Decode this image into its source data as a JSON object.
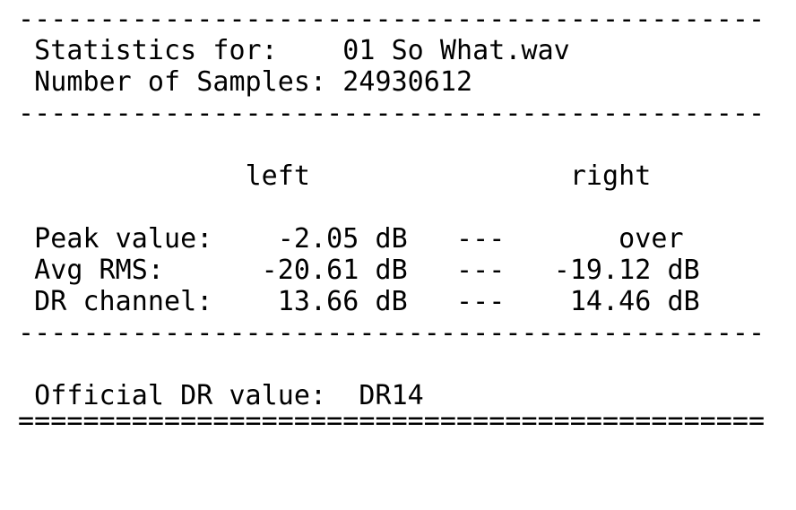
{
  "report": {
    "separator_dash": "----------------------------------------------",
    "separator_equals": "==============================================",
    "header": {
      "statistics_label": " Statistics for:    ",
      "statistics_value": "01 So What.wav",
      "samples_label": " Number of Samples: ",
      "samples_value": "24930612"
    },
    "columns": {
      "spacer": "              ",
      "left_label": "left",
      "gap": "                ",
      "right_label": "right"
    },
    "rows": [
      {
        "label": " Peak value:  ",
        "left": "  -2.05 dB",
        "sep": "   ---   ",
        "right": "    over"
      },
      {
        "label": " Avg RMS:     ",
        "left": " -20.61 dB",
        "sep": "   ---   ",
        "right": "-19.12 dB"
      },
      {
        "label": " DR channel:  ",
        "left": "  13.66 dB",
        "sep": "   ---   ",
        "right": " 14.46 dB"
      }
    ],
    "official": {
      "label": " Official DR value:  ",
      "value": "DR14"
    }
  },
  "chart_data": {
    "type": "table",
    "title": "Statistics for: 01 So What.wav",
    "columns": [
      "metric",
      "left",
      "right"
    ],
    "rows": [
      {
        "metric": "Peak value",
        "left": "-2.05 dB",
        "right": "over"
      },
      {
        "metric": "Avg RMS",
        "left": "-20.61 dB",
        "right": "-19.12 dB"
      },
      {
        "metric": "DR channel",
        "left": "13.66 dB",
        "right": "14.46 dB"
      }
    ],
    "number_of_samples": 24930612,
    "official_dr_value": "DR14"
  }
}
